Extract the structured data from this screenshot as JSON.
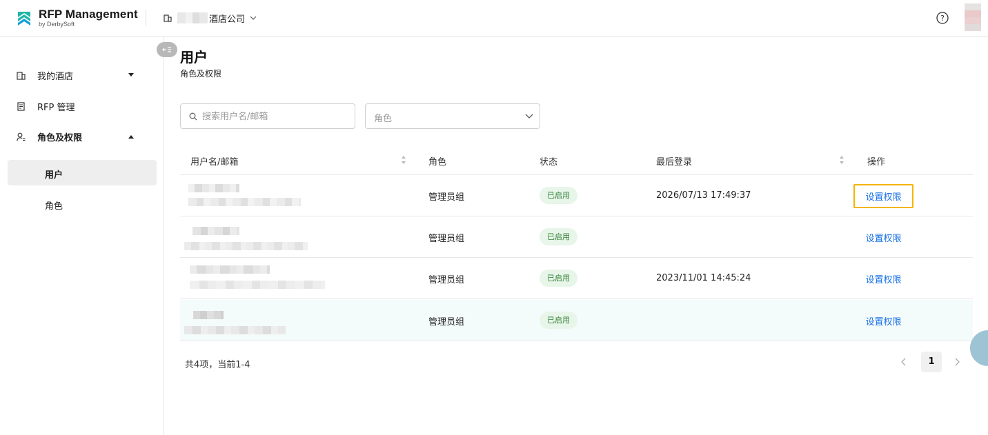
{
  "app": {
    "title": "RFP Management",
    "subtitle": "by DerbySoft",
    "org_name": "酒店公司"
  },
  "sidebar": {
    "items": [
      {
        "label": "我的酒店",
        "icon": "building-icon"
      },
      {
        "label": "RFP 管理",
        "icon": "document-icon"
      },
      {
        "label": "角色及权限",
        "icon": "user-permission-icon"
      }
    ],
    "subitems": [
      {
        "label": "用户",
        "active": true
      },
      {
        "label": "角色",
        "active": false
      }
    ]
  },
  "page": {
    "title": "用户",
    "subtitle": "角色及权限"
  },
  "filters": {
    "search_placeholder": "搜索用户名/邮箱",
    "role_placeholder": "角色"
  },
  "table": {
    "headers": {
      "user": "用户名/邮箱",
      "role": "角色",
      "status": "状态",
      "last_login": "最后登录",
      "action": "操作"
    },
    "rows": [
      {
        "role": "管理员组",
        "status": "已启用",
        "last_login": "2026/07/13 17:49:37",
        "action": "设置权限"
      },
      {
        "role": "管理员组",
        "status": "已启用",
        "last_login": "",
        "action": "设置权限"
      },
      {
        "role": "管理员组",
        "status": "已启用",
        "last_login": "2023/11/01 14:45:24",
        "action": "设置权限"
      },
      {
        "role": "管理员组",
        "status": "已启用",
        "last_login": "",
        "action": "设置权限"
      }
    ]
  },
  "pagination": {
    "total_text": "共4项，当前1-4",
    "current_page": "1"
  },
  "colors": {
    "brand": "#1fb6a8",
    "link": "#1a73e8",
    "status_bg": "#e8f5e9",
    "status_text": "#2e7d32",
    "focus": "#f5b400"
  }
}
